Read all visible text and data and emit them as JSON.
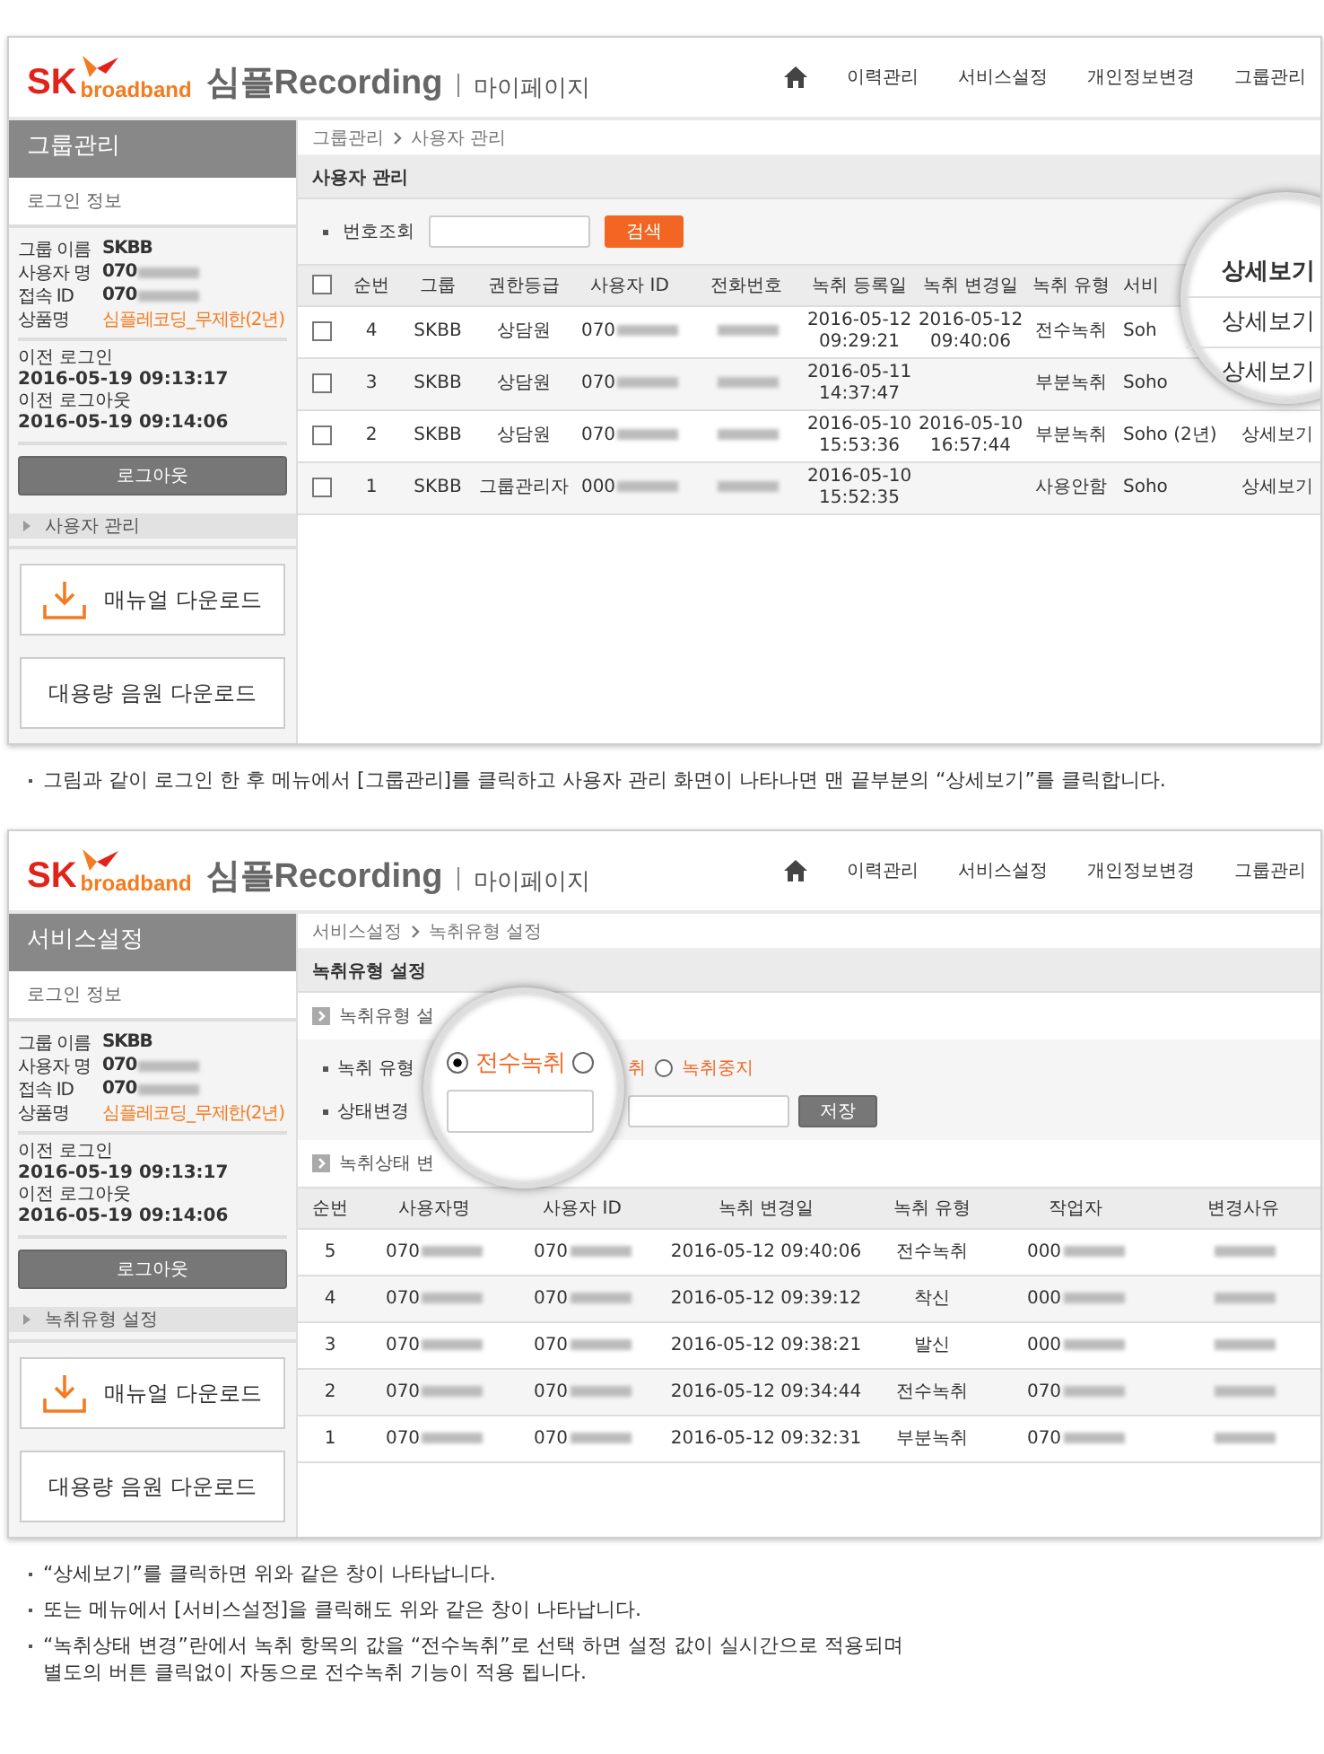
{
  "panels": [
    {
      "header": {
        "logo_sk": "SK",
        "logo_sub": "broadband",
        "brand": "심플Recording",
        "page": "마이페이지",
        "nav": [
          "이력관리",
          "서비스설정",
          "개인정보변경",
          "그룹관리"
        ]
      },
      "sidebar": {
        "title": "그룹관리",
        "login_label": "로그인 정보",
        "info": [
          {
            "label": "그룹 이름",
            "value": "SKBB",
            "kind": "plain"
          },
          {
            "label": "사용자 명",
            "value": "070",
            "kind": "blurred"
          },
          {
            "label": "접속 ID",
            "value": "070",
            "kind": "blurred"
          },
          {
            "label": "상품명",
            "value": "심플레코딩_무제한(2년)",
            "kind": "highlight"
          }
        ],
        "prev_login_label": "이전 로그인",
        "prev_login": "2016-05-19 09:13:17",
        "prev_logout_label": "이전 로그아웃",
        "prev_logout": "2016-05-19 09:14:06",
        "logout": "로그아웃",
        "menu_item": "사용자 관리",
        "downloads": [
          {
            "label": "매뉴얼 다운로드",
            "icon": true
          },
          {
            "label": "대용량 음원 다운로드",
            "icon": false
          }
        ]
      },
      "breadcrumb": [
        "그룹관리",
        "사용자 관리"
      ],
      "title": "사용자 관리",
      "content": {
        "kind": "user_list",
        "search_label": "번호조회",
        "search_button": "검색",
        "magnifier": [
          "상세보기",
          "상세보기",
          "상세보기"
        ],
        "table": {
          "header_checked": false,
          "columns": [
            "순번",
            "그룹",
            "권한등급",
            "사용자 ID",
            "전화번호",
            "녹취 등록일",
            "녹취 변경일",
            "녹취 유형",
            "서비"
          ],
          "rows": [
            {
              "checked": false,
              "cells": [
                {
                  "text": "4"
                },
                {
                  "text": "SKBB"
                },
                {
                  "text": "상담원"
                },
                {
                  "text": "070",
                  "blurred": true
                },
                {
                  "blurred": true
                },
                {
                  "text": "2016-05-12\n09:29:21"
                },
                {
                  "text": "2016-05-12\n09:40:06"
                },
                {
                  "text": "전수녹취"
                },
                {
                  "text": "Soh"
                }
              ]
            },
            {
              "checked": false,
              "cells": [
                {
                  "text": "3"
                },
                {
                  "text": "SKBB"
                },
                {
                  "text": "상담원"
                },
                {
                  "text": "070",
                  "blurred": true
                },
                {
                  "blurred": true
                },
                {
                  "text": "2016-05-11\n14:37:47"
                },
                {},
                {
                  "text": "부분녹취"
                },
                {
                  "text": "Soho"
                }
              ]
            },
            {
              "checked": false,
              "cells": [
                {
                  "text": "2"
                },
                {
                  "text": "SKBB"
                },
                {
                  "text": "상담원"
                },
                {
                  "text": "070",
                  "blurred": true
                },
                {
                  "blurred": true
                },
                {
                  "text": "2016-05-10\n15:53:36"
                },
                {
                  "text": "2016-05-10\n16:57:44"
                },
                {
                  "text": "부분녹취"
                },
                {
                  "text": "Soho (2년)"
                }
              ],
              "detail": "상세보기"
            },
            {
              "checked": false,
              "cells": [
                {
                  "text": "1"
                },
                {
                  "text": "SKBB"
                },
                {
                  "text": "그룹관리자"
                },
                {
                  "text": "000",
                  "blurred": true
                },
                {
                  "blurred": true
                },
                {
                  "text": "2016-05-10\n15:52:35"
                },
                {},
                {
                  "text": "사용안함"
                },
                {
                  "text": "Soho"
                }
              ],
              "detail": "상세보기"
            }
          ]
        }
      },
      "notes": [
        "그림과 같이 로그인 한 후 메뉴에서 [그룹관리]를 클릭하고 사용자 관리 화면이 나타나면 맨 끝부분의 “상세보기”를 클릭합니다."
      ]
    },
    {
      "header": {
        "logo_sk": "SK",
        "logo_sub": "broadband",
        "brand": "심플Recording",
        "page": "마이페이지",
        "nav": [
          "이력관리",
          "서비스설정",
          "개인정보변경",
          "그룹관리"
        ]
      },
      "sidebar": {
        "title": "서비스설정",
        "login_label": "로그인 정보",
        "info": [
          {
            "label": "그룹 이름",
            "value": "SKBB",
            "kind": "plain"
          },
          {
            "label": "사용자 명",
            "value": "070",
            "kind": "blurred"
          },
          {
            "label": "접속 ID",
            "value": "070",
            "kind": "blurred"
          },
          {
            "label": "상품명",
            "value": "심플레코딩_무제한(2년)",
            "kind": "highlight"
          }
        ],
        "prev_login_label": "이전 로그인",
        "prev_login": "2016-05-19 09:13:17",
        "prev_logout_label": "이전 로그아웃",
        "prev_logout": "2016-05-19 09:14:06",
        "logout": "로그아웃",
        "menu_item": "녹취유형 설정",
        "downloads": [
          {
            "label": "매뉴얼 다운로드",
            "icon": true
          },
          {
            "label": "대용량 음원 다운로드",
            "icon": false
          }
        ]
      },
      "breadcrumb": [
        "서비스설정",
        "녹취유형 설정"
      ],
      "title": "녹취유형 설정",
      "content": {
        "kind": "type_setting",
        "sub1": "녹취유형 설",
        "type_label": "녹취 유형",
        "state_label": "상태변경",
        "save": "저장",
        "sub2": "녹취상태 변",
        "options": [
          {
            "label": "전수녹취",
            "selected": true,
            "kind": "magnified"
          },
          {
            "label": "취",
            "selected": false,
            "kind": "split"
          },
          {
            "label": "녹취중지",
            "selected": false,
            "kind": "plain"
          }
        ],
        "table": {
          "columns": [
            "순번",
            "사용자명",
            "사용자 ID",
            "녹취 변경일",
            "녹취 유형",
            "작업자",
            "변경사유"
          ],
          "rows": [
            {
              "cells": [
                {
                  "text": "5"
                },
                {
                  "text": "070",
                  "blurred": true
                },
                {
                  "text": "070",
                  "blurred": true
                },
                {
                  "text": "2016-05-12 09:40:06"
                },
                {
                  "text": "전수녹취"
                },
                {
                  "text": "000",
                  "blurred": true
                },
                {
                  "blurred": true
                }
              ]
            },
            {
              "cells": [
                {
                  "text": "4"
                },
                {
                  "text": "070",
                  "blurred": true
                },
                {
                  "text": "070",
                  "blurred": true
                },
                {
                  "text": "2016-05-12 09:39:12"
                },
                {
                  "text": "착신"
                },
                {
                  "text": "000",
                  "blurred": true
                },
                {
                  "blurred": true
                }
              ]
            },
            {
              "cells": [
                {
                  "text": "3"
                },
                {
                  "text": "070",
                  "blurred": true
                },
                {
                  "text": "070",
                  "blurred": true
                },
                {
                  "text": "2016-05-12 09:38:21"
                },
                {
                  "text": "발신"
                },
                {
                  "text": "000",
                  "blurred": true
                },
                {
                  "blurred": true
                }
              ]
            },
            {
              "cells": [
                {
                  "text": "2"
                },
                {
                  "text": "070",
                  "blurred": true
                },
                {
                  "text": "070",
                  "blurred": true
                },
                {
                  "text": "2016-05-12 09:34:44"
                },
                {
                  "text": "전수녹취"
                },
                {
                  "text": "070",
                  "blurred": true
                },
                {
                  "blurred": true
                }
              ]
            },
            {
              "cells": [
                {
                  "text": "1"
                },
                {
                  "text": "070",
                  "blurred": true
                },
                {
                  "text": "070",
                  "blurred": true
                },
                {
                  "text": "2016-05-12 09:32:31"
                },
                {
                  "text": "부분녹취"
                },
                {
                  "text": "070",
                  "blurred": true
                },
                {
                  "blurred": true
                }
              ]
            }
          ]
        }
      },
      "notes": [
        "“상세보기”를 클릭하면 위와 같은 창이 나타납니다.",
        "또는 메뉴에서 [서비스설정]을 클릭해도 위와 같은 창이 나타납니다.",
        "“녹취상태 변경”란에서 녹취 항목의 값을 “전수녹취”로 선택 하면 설정 값이 실시간으로 적용되며\n별도의 버튼 클릭없이 자동으로 전수녹취 기능이 적용 됩니다."
      ]
    }
  ]
}
